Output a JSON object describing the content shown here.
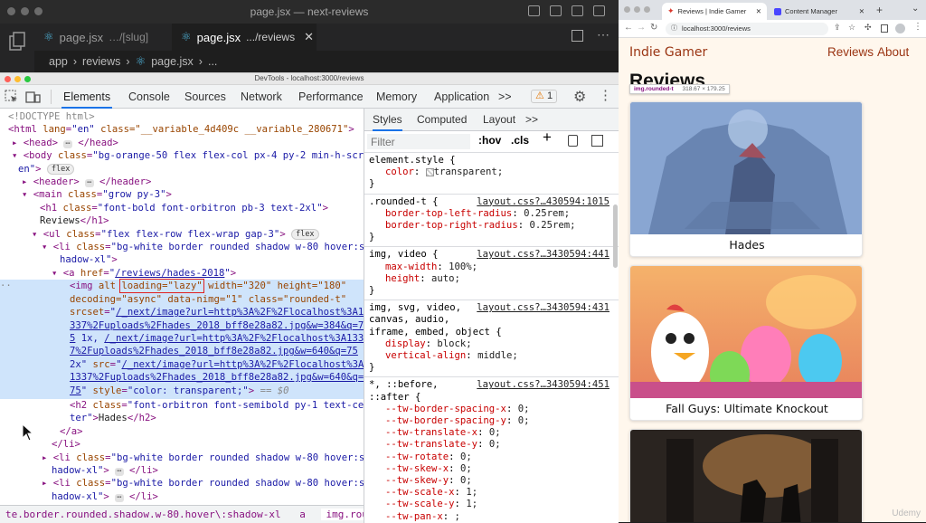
{
  "vscode": {
    "title": "page.jsx — next-reviews",
    "tabs": [
      {
        "name": "page.jsx",
        "path": "…/[slug]"
      },
      {
        "name": "page.jsx",
        "path": ".../reviews"
      }
    ],
    "breadcrumb": [
      "app",
      "reviews",
      "page.jsx",
      "..."
    ]
  },
  "devtools": {
    "title": "DevTools - localhost:3000/reviews",
    "tabs": [
      "Elements",
      "Console",
      "Sources",
      "Network",
      "Performance",
      "Memory",
      "Application"
    ],
    "more": ">>",
    "warning_count": "1",
    "elements": {
      "doctype": "<!DOCTYPE html>",
      "html_attr": "class=\"__variable_4d409c __variable_280671\"",
      "body_class_1": "bg-orange-50 flex flex-col px-4 py-2 min-h-scre",
      "body_class_2": "en",
      "h1_class": "font-bold font-orbitron pb-3 text-2xl",
      "h1_text": "Reviews",
      "ul_class": "flex flex-row flex-wrap gap-3",
      "li_class_1": "bg-white border rounded shadow w-80 hover:s",
      "li_class_2": "hadow-xl",
      "a_href": "/reviews/hades-2018",
      "img_loading": "loading=\"lazy\"",
      "img_rest": "width=\"320\" height=\"180\"",
      "img_l2": "decoding=\"async\" data-nimg=\"1\" class=\"rounded-t\"",
      "srcset_1": "/_next/image?url=http%3A%2F%2Flocalhost%3A1",
      "srcset_2": "337%2Fuploads%2Fhades_2018_bff8e28a82.jpg&w=384&q=7",
      "srcset_3": "5",
      "srcset_3b": "/_next/image?url=http%3A%2F%2Flocalhost%3A133",
      "srcset_4": "7%2Fuploads%2Fhades_2018_bff8e28a82.jpg&w=640&q=75",
      "src_1": "/_next/image?url=http%3A%2F%2Flocalhost%3A",
      "src_2": "1337%2Fuploads%2Fhades_2018_bff8e28a82.jpg&w=640&q=",
      "src_3": "75",
      "style_val": "color: transparent;",
      "h2_class_1": "font-orbitron font-semibold py-1 text-cen",
      "h2_class_2": "ter",
      "h2_text": "Hades",
      "flex_badge": "flex"
    },
    "breadcrumbs": [
      "te.border.rounded.shadow.w-80.hover\\:shadow-xl",
      "a",
      "img.rounded-t"
    ]
  },
  "styles": {
    "tabs": [
      "Styles",
      "Computed",
      "Layout",
      ">>"
    ],
    "filter_placeholder": "Filter",
    "hov": ":hov",
    "cls": ".cls",
    "rules": [
      {
        "selector": "element.style {",
        "source": "",
        "props": [
          {
            "n": "color",
            "v": "transparent;"
          }
        ]
      },
      {
        "selector": ".rounded-t {",
        "source": "layout.css?…430594:1015",
        "props": [
          {
            "n": "border-top-left-radius",
            "v": "0.25rem;"
          },
          {
            "n": "border-top-right-radius",
            "v": "0.25rem;"
          }
        ]
      },
      {
        "selector": "img, video {",
        "source": "layout.css?…3430594:441",
        "props": [
          {
            "n": "max-width",
            "v": "100%;"
          },
          {
            "n": "height",
            "v": "auto;"
          }
        ]
      },
      {
        "selector": "img, svg, video,",
        "selector2": "canvas, audio,",
        "selector3": "iframe, embed, object {",
        "source": "layout.css?…3430594:431",
        "props": [
          {
            "n": "display",
            "v": "block;"
          },
          {
            "n": "vertical-align",
            "v": "middle;"
          }
        ]
      },
      {
        "selector": "*, ::before,",
        "selector2": "::after {",
        "source": "layout.css?…3430594:451",
        "props": [
          {
            "n": "--tw-border-spacing-x",
            "v": "0;"
          },
          {
            "n": "--tw-border-spacing-y",
            "v": "0;"
          },
          {
            "n": "--tw-translate-x",
            "v": "0;"
          },
          {
            "n": "--tw-translate-y",
            "v": "0;"
          },
          {
            "n": "--tw-rotate",
            "v": "0;"
          },
          {
            "n": "--tw-skew-x",
            "v": "0;"
          },
          {
            "n": "--tw-skew-y",
            "v": "0;"
          },
          {
            "n": "--tw-scale-x",
            "v": "1;"
          },
          {
            "n": "--tw-scale-y",
            "v": "1;"
          },
          {
            "n": "--tw-pan-x",
            "v": ";"
          }
        ]
      }
    ]
  },
  "chrome": {
    "tabs": [
      "Reviews | Indie Gamer",
      "Content Manager"
    ],
    "url": "localhost:3000/reviews",
    "site_title": "Indie Gamer",
    "nav": [
      "Reviews",
      "About"
    ],
    "heading": "Reviews",
    "tooltip_tag": "img.rounded-t",
    "tooltip_size": "318.67 × 179.25",
    "cards": [
      "Hades",
      "Fall Guys: Ultimate Knockout",
      ""
    ]
  },
  "watermark": "Udemy"
}
